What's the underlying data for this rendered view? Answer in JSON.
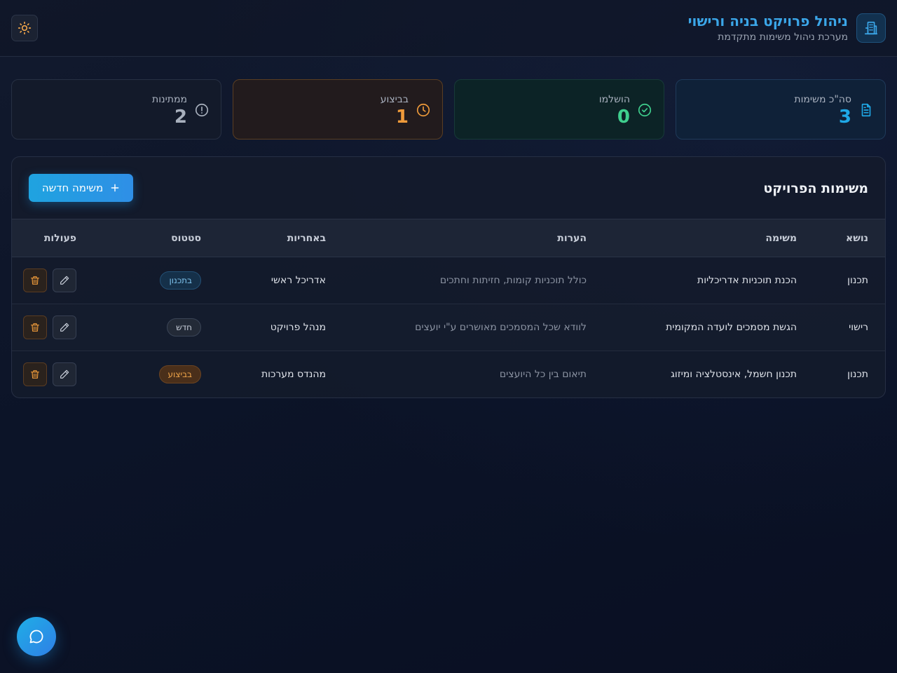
{
  "header": {
    "title": "ניהול פרויקט בניה ורישוי",
    "subtitle": "מערכת ניהול משימות מתקדמת",
    "brand_icon": "building-icon",
    "theme_icon": "sun-icon"
  },
  "stats": {
    "total": {
      "label": "סה\"כ משימות",
      "value": "3",
      "icon": "document-icon",
      "color": "#1fa8e6"
    },
    "done": {
      "label": "הושלמו",
      "value": "0",
      "icon": "check-circle-icon",
      "color": "#3fcf8e"
    },
    "in_progress": {
      "label": "בביצוע",
      "value": "1",
      "icon": "clock-icon",
      "color": "#ee9a3a"
    },
    "waiting": {
      "label": "ממתינות",
      "value": "2",
      "icon": "alert-circle-icon",
      "color": "#a8b0bd"
    }
  },
  "panel": {
    "title": "משימות הפרויקט",
    "new_task_label": "משימה חדשה"
  },
  "table": {
    "columns": {
      "topic": "נושא",
      "task": "משימה",
      "notes": "הערות",
      "owner": "באחריות",
      "status": "סטטוס",
      "actions": "פעולות"
    },
    "rows": [
      {
        "topic": "תכנון",
        "task": "הכנת תוכניות אדריכליות",
        "notes": "כולל תוכניות קומות, חזיתות וחתכים",
        "owner": "אדריכל ראשי",
        "status": "בתכנון"
      },
      {
        "topic": "רישוי",
        "task": "הגשת מסמכים לועדה המקומית",
        "notes": "לוודא שכל המסמכים מאושרים ע\"י יועצים",
        "owner": "מנהל פרויקט",
        "status": "חדש"
      },
      {
        "topic": "תכנון",
        "task": "תכנון חשמל, אינסטלציה ומיזוג",
        "notes": "תיאום בין כל היועצים",
        "owner": "מהנדס מערכות",
        "status": "בביצוע"
      }
    ]
  },
  "colors": {
    "accent": "#1fa3e0",
    "danger": "#ee9a3a"
  }
}
